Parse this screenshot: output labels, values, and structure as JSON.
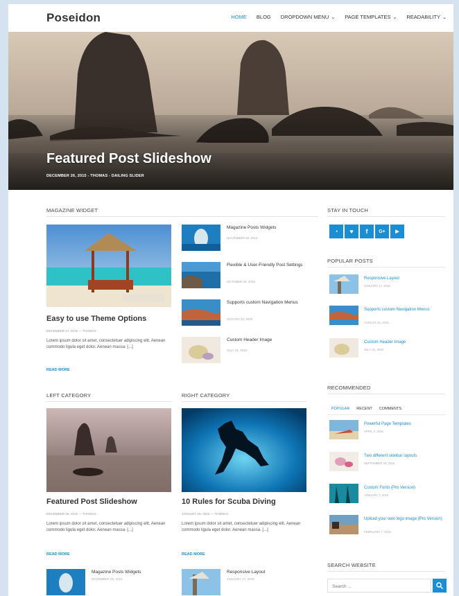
{
  "header": {
    "site_title": "Poseidon",
    "nav": [
      {
        "label": "HOME",
        "dropdown": false,
        "active": true
      },
      {
        "label": "BLOG",
        "dropdown": false,
        "active": false
      },
      {
        "label": "DROPDOWN MENU",
        "dropdown": true,
        "active": false
      },
      {
        "label": "PAGE TEMPLATES",
        "dropdown": true,
        "active": false
      },
      {
        "label": "READABILITY",
        "dropdown": true,
        "active": false
      }
    ]
  },
  "hero": {
    "title": "Featured Post Slideshow",
    "meta": "DECEMBER 26, 2015 - THOMAS - DAILING SLIDER"
  },
  "magazine": {
    "section_title": "MAGAZINE WIDGET",
    "main": {
      "title": "Easy to use Theme Options",
      "meta": "DECEMBER 17, 2015 — THOMAS",
      "excerpt": "Lorem ipsum dolor sit amet, consectetuer adipiscing elit. Aenean commodo ligula eget dolor. Aenean massa. [...]",
      "read_more": "READ MORE"
    },
    "list": [
      {
        "title": "Magazine Posts Widgets",
        "date": "NOVEMBER 29, 2015"
      },
      {
        "title": "Flexible & User-Friendly Post Settings",
        "date": "OCTOBER 30, 2015"
      },
      {
        "title": "Supports custom Navigation Menus",
        "date": "AUGUST 22, 2015"
      },
      {
        "title": "Custom Header Image",
        "date": "JULY 31, 2015"
      }
    ]
  },
  "left_category": {
    "section_title": "LEFT CATEGORY",
    "main": {
      "title": "Featured Post Slideshow",
      "meta": "DECEMBER 26, 2015 — THOMAS",
      "excerpt": "Lorem ipsum dolor sit amet, consectetuer adipiscing elit. Aenean commodo ligula eget dolor. Aenean massa. [...]",
      "read_more": "READ MORE"
    },
    "list": [
      {
        "title": "Magazine Posts Widgets",
        "date": "NOVEMBER 29, 2015"
      }
    ]
  },
  "right_category": {
    "section_title": "RIGHT CATEGORY",
    "main": {
      "title": "10 Rules for Scuba Diving",
      "meta": "JANUARY 29, 2015 — THOMAS",
      "excerpt": "Lorem ipsum dolor sit amet, consectetuer adipiscing elit. Aenean commodo ligula eget dolor. Aenean massa. [...]",
      "read_more": "READ MORE"
    },
    "list": [
      {
        "title": "Responsive Layout",
        "date": "JANUARY 17, 2015"
      }
    ]
  },
  "sidebar": {
    "stay_in_touch": "STAY IN TOUCH",
    "social": [
      {
        "name": "rss-icon",
        "glyph": "◔"
      },
      {
        "name": "twitter-icon",
        "glyph": "♥"
      },
      {
        "name": "facebook-icon",
        "glyph": "f"
      },
      {
        "name": "googleplus-icon",
        "glyph": "G+"
      },
      {
        "name": "youtube-icon",
        "glyph": "▶"
      }
    ],
    "popular_title": "POPULAR POSTS",
    "popular": [
      {
        "title": "Responsive Layout",
        "date": "JANUARY 17, 2015"
      },
      {
        "title": "Supports custom Navigation Menus",
        "date": "AUGUST 22, 2015"
      },
      {
        "title": "Custom Header Image",
        "date": "JULY 31, 2015"
      }
    ],
    "recommended_title": "RECOMMENDED",
    "tabs": [
      "POPULAR",
      "RECENT",
      "COMMENTS"
    ],
    "recommended": [
      {
        "title": "Powerful Page Templates",
        "date": "APRIL 3, 2015"
      },
      {
        "title": "Two different sidebar layouts",
        "date": "SEPTEMBER 18, 2015"
      },
      {
        "title": "Custom Fonts (Pro Version)",
        "date": "JANUARY 7, 2015"
      },
      {
        "title": "Upload your own logo image (Pro Version)",
        "date": "FEBRUARY 7, 2015"
      }
    ],
    "search_title": "SEARCH WEBSITE",
    "search_placeholder": "Search ..."
  },
  "colors": {
    "accent": "#1a8ed5"
  }
}
